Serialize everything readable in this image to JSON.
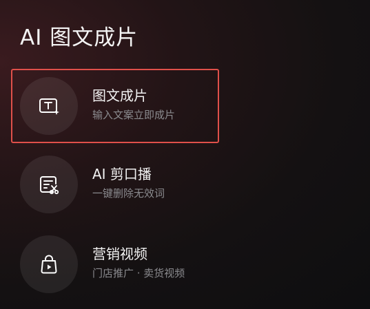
{
  "page": {
    "title": "AI 图文成片"
  },
  "menu": {
    "items": [
      {
        "title": "图文成片",
        "subtitle": "输入文案立即成片",
        "icon": "text-to-video-icon",
        "selected": true
      },
      {
        "title": "AI 剪口播",
        "subtitle": "一键删除无效词",
        "icon": "cut-script-icon",
        "selected": false
      },
      {
        "title": "营销视频",
        "subtitle": "门店推广 · 卖货视频",
        "icon": "shopping-bag-play-icon",
        "selected": false
      }
    ]
  },
  "colors": {
    "selection_border": "#e0504a",
    "subtitle": "#8b8b8f"
  }
}
